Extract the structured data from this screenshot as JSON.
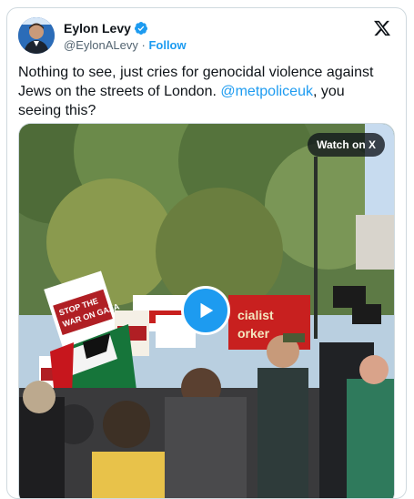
{
  "author": {
    "display_name": "Eylon Levy",
    "handle": "@EylonALevy",
    "separator": "·",
    "follow_label": "Follow"
  },
  "tweet": {
    "text_before": "Nothing to see, just cries for genocidal violence against Jews on the streets of London. ",
    "mention": "@metpoliceuk",
    "text_after": ", you seeing this?"
  },
  "media": {
    "watch_label": "Watch on X",
    "play_icon": "play-icon"
  },
  "icons": {
    "verified": "verified-badge-icon",
    "brand": "x-logo-icon"
  },
  "colors": {
    "accent": "#1d9bf0",
    "text": "#0f1419",
    "muted": "#536471",
    "border": "#cfd9de"
  }
}
